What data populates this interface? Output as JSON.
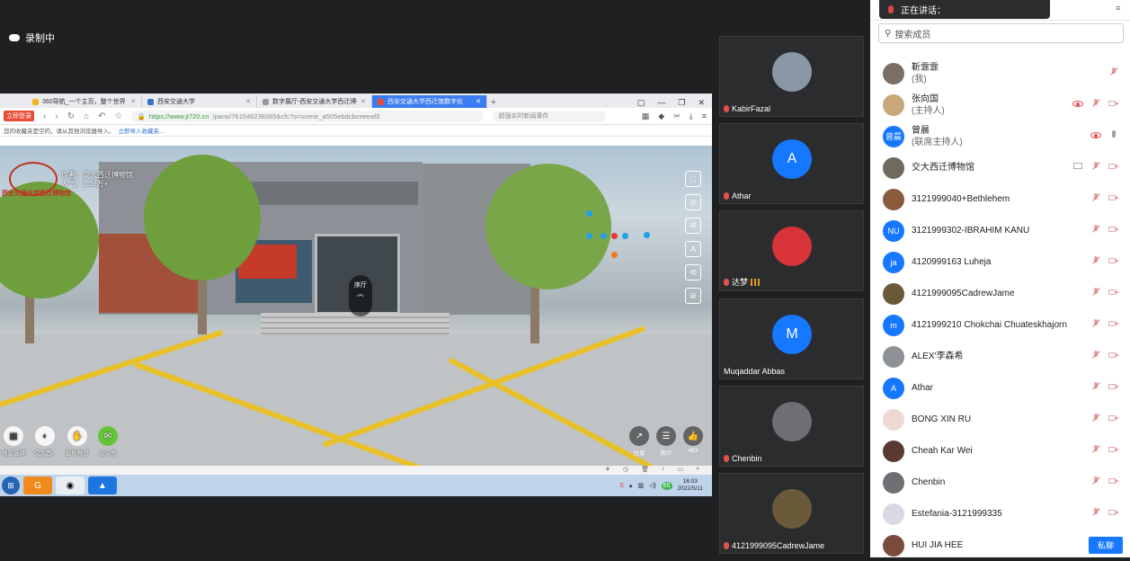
{
  "recording": {
    "label": "录制中"
  },
  "browser": {
    "tabs": [
      {
        "label": "360导航_一个主页，整个世界",
        "active": false
      },
      {
        "label": "西安交通大学",
        "active": false
      },
      {
        "label": "数字展厅-西安交通大学西迁博物馆",
        "active": false
      },
      {
        "label": "西安交通大学西迁馆数字化",
        "active": true
      }
    ],
    "login_btn": "立即登录",
    "url_host": "https://www.jt720.cn",
    "url_path": "/pano/761548238365&cfc?s=scene_a505ebdcbceeeaf3",
    "search_placeholder": "超强实时新闻事件",
    "bookmark_hint": "您的收藏夹是空的，请从其他浏览器导入。",
    "bookmark_link": "立即导入收藏夹..."
  },
  "pano": {
    "logo_text": "西安交通大学西迁博物馆",
    "author_line1": "作者：交大西迁博物馆",
    "author_line2": "人气：2.36万+",
    "hall_label": "序厅",
    "bottom_icons": [
      {
        "label": "场景选择",
        "icon": "grid-icon"
      },
      {
        "label": "交大西...",
        "icon": "globe-icon"
      },
      {
        "label": "鼠标导览",
        "icon": "hand-icon"
      },
      {
        "label": "公众号",
        "icon": "wechat-icon"
      }
    ],
    "right_icons": [
      {
        "label": "分享",
        "icon": "share-icon"
      },
      {
        "label": "简介",
        "icon": "doc-icon"
      },
      {
        "label": "483",
        "icon": "thumbs-up-icon"
      }
    ]
  },
  "taskbar": {
    "clock_time": "16:03",
    "clock_date": "2022/5/11",
    "tray_badge": "65"
  },
  "speaking": {
    "label": "正在讲话："
  },
  "video_tiles": [
    {
      "name": "KabirFazal",
      "avatar_letter": "",
      "avatar_color": "#8a98a6",
      "signal": false
    },
    {
      "name": "Athar",
      "avatar_letter": "A",
      "avatar_color": "#1677ff",
      "signal": false
    },
    {
      "name": "达梦",
      "avatar_letter": "",
      "avatar_color": "#d9333a",
      "signal": true
    },
    {
      "name": "Muqaddar Abbas",
      "avatar_letter": "M",
      "avatar_color": "#1677ff",
      "signal": false
    },
    {
      "name": "Chenbin",
      "avatar_letter": "",
      "avatar_color": "#6d6f72",
      "signal": false
    },
    {
      "name": "4121999095CadrewJame",
      "avatar_letter": "",
      "avatar_color": "#6b5a3a",
      "signal": false
    }
  ],
  "members": {
    "search_placeholder": "搜索成员",
    "private_chat_btn": "私聊",
    "list": [
      {
        "name": "靳霏霏",
        "sub": "(我)",
        "avatar_letter": "",
        "avatar_color": "#7a6f66",
        "icons": [
          "mic-off-icon"
        ]
      },
      {
        "name": "张向国",
        "sub": "(主持人)",
        "avatar_letter": "",
        "avatar_color": "#c8a77a",
        "icons": [
          "eye-icon",
          "mic-off-icon",
          "camera-off-icon"
        ]
      },
      {
        "name": "曾晨",
        "sub": "(联席主持人)",
        "avatar_letter": "曾晨",
        "avatar_color": "#1677ff",
        "icons": [
          "eye-icon",
          "mic-icon"
        ]
      },
      {
        "name": "交大西迁博物馆",
        "sub": "",
        "avatar_letter": "",
        "avatar_color": "#6e6a5c",
        "icons": [
          "screen-icon",
          "mic-off-icon",
          "camera-off-icon"
        ]
      },
      {
        "name": "3121999040+Bethlehem",
        "sub": "",
        "avatar_letter": "",
        "avatar_color": "#8a5a3c",
        "icons": [
          "mic-off-icon",
          "camera-off-icon"
        ]
      },
      {
        "name": "3121999302-IBRAHIM KANU",
        "sub": "",
        "avatar_letter": "NU",
        "avatar_color": "#1677ff",
        "icons": [
          "mic-off-icon",
          "camera-off-icon"
        ]
      },
      {
        "name": "4120999163 Luheja",
        "sub": "",
        "avatar_letter": "ja",
        "avatar_color": "#1677ff",
        "icons": [
          "mic-off-icon",
          "camera-off-icon"
        ]
      },
      {
        "name": "4121999095CadrewJame",
        "sub": "",
        "avatar_letter": "",
        "avatar_color": "#6b5a3a",
        "icons": [
          "mic-off-icon",
          "camera-off-icon"
        ]
      },
      {
        "name": "4121999210 Chokchai Chuateskhajorn",
        "sub": "",
        "avatar_letter": "m",
        "avatar_color": "#1677ff",
        "icons": [
          "mic-off-icon",
          "camera-off-icon"
        ]
      },
      {
        "name": "ALEX'李森希",
        "sub": "",
        "avatar_letter": "",
        "avatar_color": "#8e9296",
        "icons": [
          "mic-off-icon",
          "camera-off-icon"
        ]
      },
      {
        "name": "Athar",
        "sub": "",
        "avatar_letter": "A",
        "avatar_color": "#1677ff",
        "icons": [
          "mic-off-icon",
          "camera-off-icon"
        ]
      },
      {
        "name": "BONG XIN RU",
        "sub": "",
        "avatar_letter": "",
        "avatar_color": "#efd8d2",
        "icons": [
          "mic-off-icon",
          "camera-off-icon"
        ]
      },
      {
        "name": "Cheah Kar Wei",
        "sub": "",
        "avatar_letter": "",
        "avatar_color": "#5a3a30",
        "icons": [
          "mic-off-icon",
          "camera-off-icon"
        ]
      },
      {
        "name": "Chenbin",
        "sub": "",
        "avatar_letter": "",
        "avatar_color": "#6d6f72",
        "icons": [
          "mic-off-icon",
          "camera-off-icon"
        ]
      },
      {
        "name": "Estefania-3121999335",
        "sub": "",
        "avatar_letter": "",
        "avatar_color": "#d9d9e3",
        "icons": [
          "mic-off-icon",
          "camera-off-icon"
        ]
      },
      {
        "name": "HUI JIA HEE",
        "sub": "",
        "avatar_letter": "",
        "avatar_color": "#7a4a3a",
        "icons": []
      }
    ]
  }
}
